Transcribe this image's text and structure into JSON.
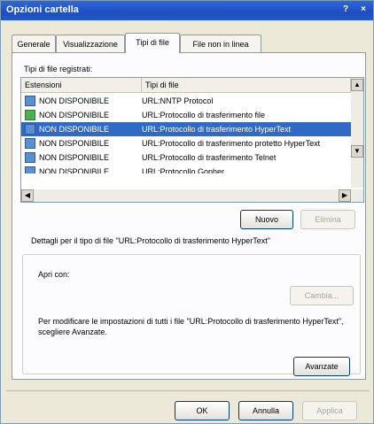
{
  "window": {
    "title": "Opzioni cartella",
    "help_glyph": "?",
    "close_glyph": "×"
  },
  "tabs": [
    {
      "label": "Generale",
      "active": false
    },
    {
      "label": "Visualizzazione",
      "active": false
    },
    {
      "label": "Tipi di file",
      "active": true
    },
    {
      "label": "File non in linea",
      "active": false
    }
  ],
  "registered_types_label": "Tipi di file registrati:",
  "list": {
    "columns": [
      "Estensioni",
      "Tipi di file"
    ],
    "rows": [
      {
        "ext": "NON DISPONIBILE",
        "type": "URL:NNTP Protocol",
        "selected": false
      },
      {
        "ext": "NON DISPONIBILE",
        "type": "URL:Protocollo di trasferimento file",
        "selected": false
      },
      {
        "ext": "NON DISPONIBILE",
        "type": "URL:Protocollo di trasferimento HyperText",
        "selected": true
      },
      {
        "ext": "NON DISPONIBILE",
        "type": "URL:Protocollo di trasferimento protetto HyperText",
        "selected": false
      },
      {
        "ext": "NON DISPONIBILE",
        "type": "URL:Protocollo di trasferimento Telnet",
        "selected": false
      },
      {
        "ext": "NON DISPONIBILE",
        "type": "URL:Protocollo Gopher",
        "selected": false
      }
    ]
  },
  "buttons": {
    "new": "Nuovo",
    "delete": "Elimina",
    "change": "Cambia...",
    "advanced": "Avanzate",
    "ok": "OK",
    "cancel": "Annulla",
    "apply": "Applica"
  },
  "details": {
    "heading": "Dettagli per il tipo di file \"URL:Protocollo di trasferimento HyperText\"",
    "opens_with_label": "Apri con:",
    "description": "Per modificare le impostazioni di tutti i file \"URL:Protocollo di trasferimento HyperText\", scegliere Avanzate."
  }
}
